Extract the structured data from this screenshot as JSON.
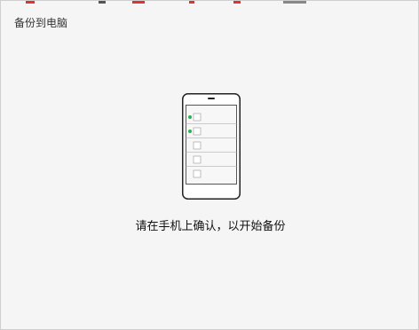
{
  "dialog": {
    "title": "备份到电脑",
    "message": "请在手机上确认，以开始备份"
  },
  "phone_illustration": {
    "icon": "phone-icon",
    "rows": [
      {
        "checked": true
      },
      {
        "checked": true
      },
      {
        "checked": false
      },
      {
        "checked": false
      },
      {
        "checked": false
      }
    ]
  },
  "colors": {
    "background": "#f5f5f5",
    "border": "#cfcfcf",
    "check_dot": "#2db34a",
    "phone_outline": "#222222",
    "row_line": "#bdbdbd"
  }
}
